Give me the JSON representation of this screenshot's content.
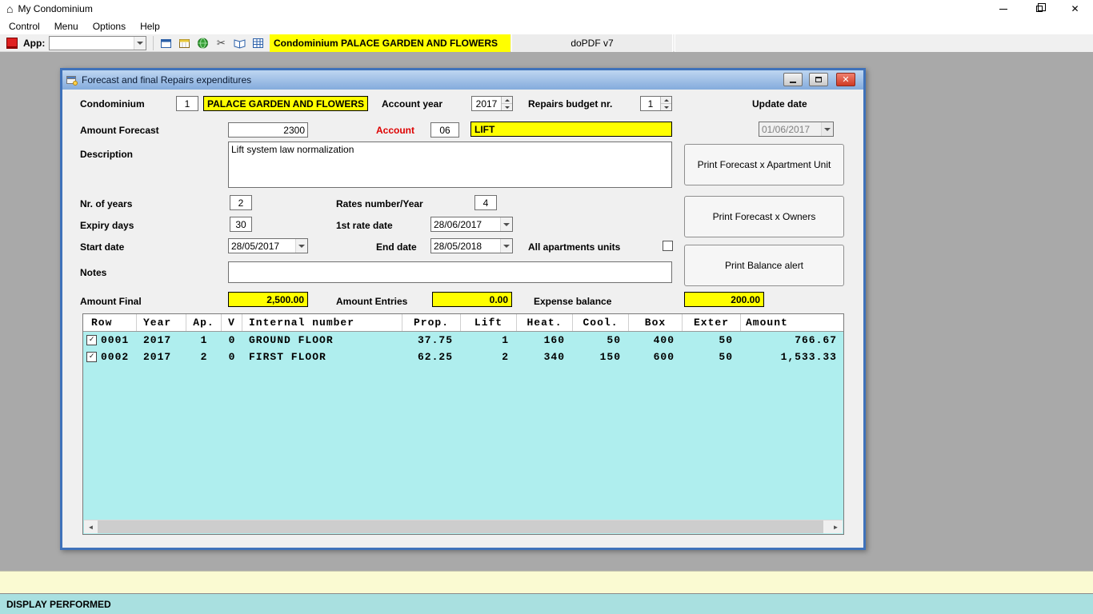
{
  "titlebar": {
    "title": "My Condominium"
  },
  "menubar": {
    "items": [
      "Control",
      "Menu",
      "Options",
      "Help"
    ]
  },
  "toolbar": {
    "app_label": "App:",
    "app_value": "",
    "icon_buttons": [
      "window-icon",
      "calendar-icon",
      "globe-icon",
      "cut-icon",
      "book-icon",
      "grid-icon"
    ],
    "condominium_banner": "Condominium PALACE GARDEN AND FLOWERS",
    "pdf_panel": "doPDF v7"
  },
  "dialog": {
    "title": "Forecast and final Repairs expenditures",
    "condominium": {
      "label": "Condominium",
      "number": "1",
      "name": "PALACE GARDEN AND FLOWERS"
    },
    "account_year": {
      "label": "Account year",
      "value": "2017"
    },
    "repairs_budget": {
      "label": "Repairs budget nr.",
      "value": "1"
    },
    "update_date": {
      "label": "Update date",
      "value": "01/06/2017"
    },
    "amount_forecast": {
      "label": "Amount Forecast",
      "value": "2300"
    },
    "account": {
      "label": "Account",
      "code": "06",
      "name": "LIFT"
    },
    "description": {
      "label": "Description",
      "value": "Lift system law normalization"
    },
    "nr_of_years": {
      "label": "Nr. of years",
      "value": "2"
    },
    "rates_number": {
      "label": "Rates number/Year",
      "value": "4"
    },
    "expiry_days": {
      "label": "Expiry days",
      "value": "30"
    },
    "first_rate_date": {
      "label": "1st rate date",
      "value": "28/06/2017"
    },
    "start_date": {
      "label": "Start date",
      "value": "28/05/2017"
    },
    "end_date": {
      "label": "End date",
      "value": "28/05/2018"
    },
    "all_apartments": {
      "label": "All apartments units",
      "checked": false
    },
    "notes": {
      "label": "Notes",
      "value": ""
    },
    "amount_final": {
      "label": "Amount Final",
      "value": "2,500.00"
    },
    "amount_entries": {
      "label": "Amount Entries",
      "value": "0.00"
    },
    "expense_balance": {
      "label": "Expense balance",
      "value": "200.00"
    },
    "buttons": {
      "print_forecast_apartment": "Print Forecast x Apartment Unit",
      "print_forecast_owners": "Print Forecast x Owners",
      "print_balance_alert": "Print Balance alert"
    },
    "table": {
      "columns": [
        "Row",
        "Year",
        "Ap.",
        "V",
        "Internal number",
        "Prop.",
        "Lift",
        "Heat.",
        "Cool.",
        "Box",
        "Exter",
        "Amount"
      ],
      "rows": [
        {
          "checked": true,
          "cells": [
            "0001",
            "2017",
            "1",
            "0",
            "GROUND FLOOR",
            "37.75",
            "1",
            "160",
            "50",
            "400",
            "50",
            "766.67"
          ]
        },
        {
          "checked": true,
          "cells": [
            "0002",
            "2017",
            "2",
            "0",
            "FIRST FLOOR",
            "62.25",
            "2",
            "340",
            "150",
            "600",
            "50",
            "1,533.33"
          ]
        }
      ]
    }
  },
  "statusbar": {
    "text": "DISPLAY PERFORMED"
  },
  "icons": {
    "house": "⌂",
    "close": "✕",
    "check": "✓",
    "cut": "✂",
    "arrow_left": "◄",
    "arrow_right": "►"
  },
  "colors": {
    "highlight_yellow": "#ffff00",
    "table_background": "#afeeee",
    "status_background": "#a9e0e0",
    "accent_red": "#dd0000"
  }
}
